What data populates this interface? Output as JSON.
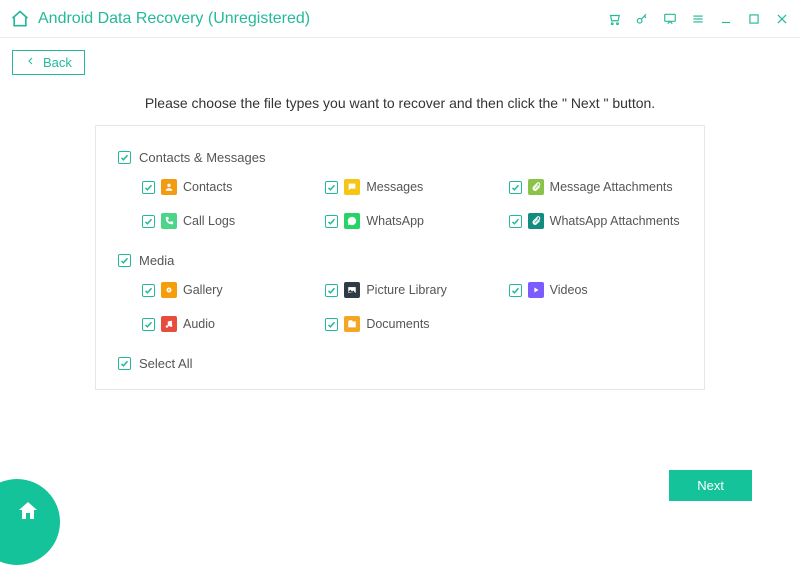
{
  "titlebar": {
    "title": "Android Data Recovery (Unregistered)"
  },
  "back": {
    "label": "Back"
  },
  "instruction": "Please choose the file types you want to recover and then click the \" Next \" button.",
  "section1": {
    "title": "Contacts & Messages",
    "contacts": "Contacts",
    "messages": "Messages",
    "message_attachments": "Message Attachments",
    "call_logs": "Call Logs",
    "whatsapp": "WhatsApp",
    "whatsapp_attachments": "WhatsApp Attachments"
  },
  "section2": {
    "title": "Media",
    "gallery": "Gallery",
    "picture_library": "Picture Library",
    "videos": "Videos",
    "audio": "Audio",
    "documents": "Documents"
  },
  "select_all": "Select All",
  "next": "Next"
}
